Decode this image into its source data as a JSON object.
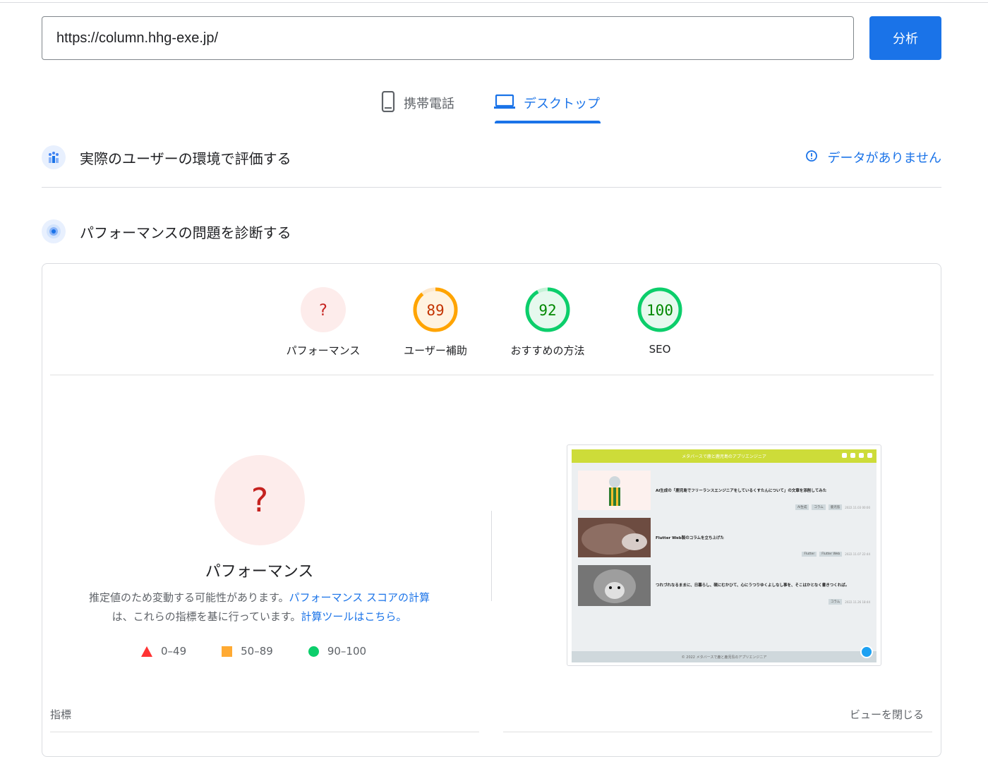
{
  "search": {
    "url_value": "https://column.hhg-exe.jp/",
    "analyze_label": "分析"
  },
  "tabs": {
    "mobile": "携帯電話",
    "desktop": "デスクトップ"
  },
  "field_data": {
    "title": "実際のユーザーの環境で評価する",
    "no_data": "データがありません"
  },
  "lab": {
    "title": "パフォーマンスの問題を診断する"
  },
  "gauges": [
    {
      "score": "?",
      "label": "パフォーマンス",
      "status": "error",
      "value": null
    },
    {
      "score": "89",
      "label": "ユーザー補助",
      "status": "average",
      "value": 89
    },
    {
      "score": "92",
      "label": "おすすめの方法",
      "status": "pass",
      "value": 92
    },
    {
      "score": "100",
      "label": "SEO",
      "status": "pass",
      "value": 100
    }
  ],
  "performance": {
    "score": "?",
    "title": "パフォーマンス",
    "desc_1": "推定値のため変動する可能性があります。",
    "desc_link_1": "パフォーマンス スコアの計算",
    "desc_2": "は、これらの指標を基に行っています。",
    "desc_link_2": "計算ツールはこちら。"
  },
  "legend": [
    {
      "range": "0–49",
      "shape": "triangle",
      "color": "#ff3333"
    },
    {
      "range": "50–89",
      "shape": "square",
      "color": "#ffaa33"
    },
    {
      "range": "90–100",
      "shape": "circle",
      "color": "#0cce6b"
    }
  ],
  "screenshot": {
    "site_title": "メタバースで鹿と鹿児島のアプリエンジニア",
    "posts": [
      {
        "title": "AI生成の「鹿児島でフリーランスエンジニアをしているくすたんについて」の文章を添削してみた",
        "tags": [
          "AI生成",
          "コラム",
          "鹿児島"
        ],
        "date": "2022.11.03 00:00"
      },
      {
        "title": "Flutter Web製のコラムを立ち上げた",
        "tags": [
          "Flutter",
          "Flutter Web"
        ],
        "date": "2022.11.07 22:44"
      },
      {
        "title": "つれづれなるままに、日暮らし、硯にむかひて、心にうつりゆくよしなし事を、そこはかとなく書きつくれば。",
        "tags": [
          "コラム"
        ],
        "date": "2022.11.26 18:44"
      }
    ],
    "footer": "© 2022 メタバースで鹿と鹿児島のアプリエンジニア"
  },
  "metrics": {
    "label": "指標",
    "close_view": "ビューを閉じる"
  },
  "colors": {
    "accent": "#1a73e8",
    "pass": "#0cce6b",
    "average": "#ffa400",
    "fail": "#ff3333"
  }
}
